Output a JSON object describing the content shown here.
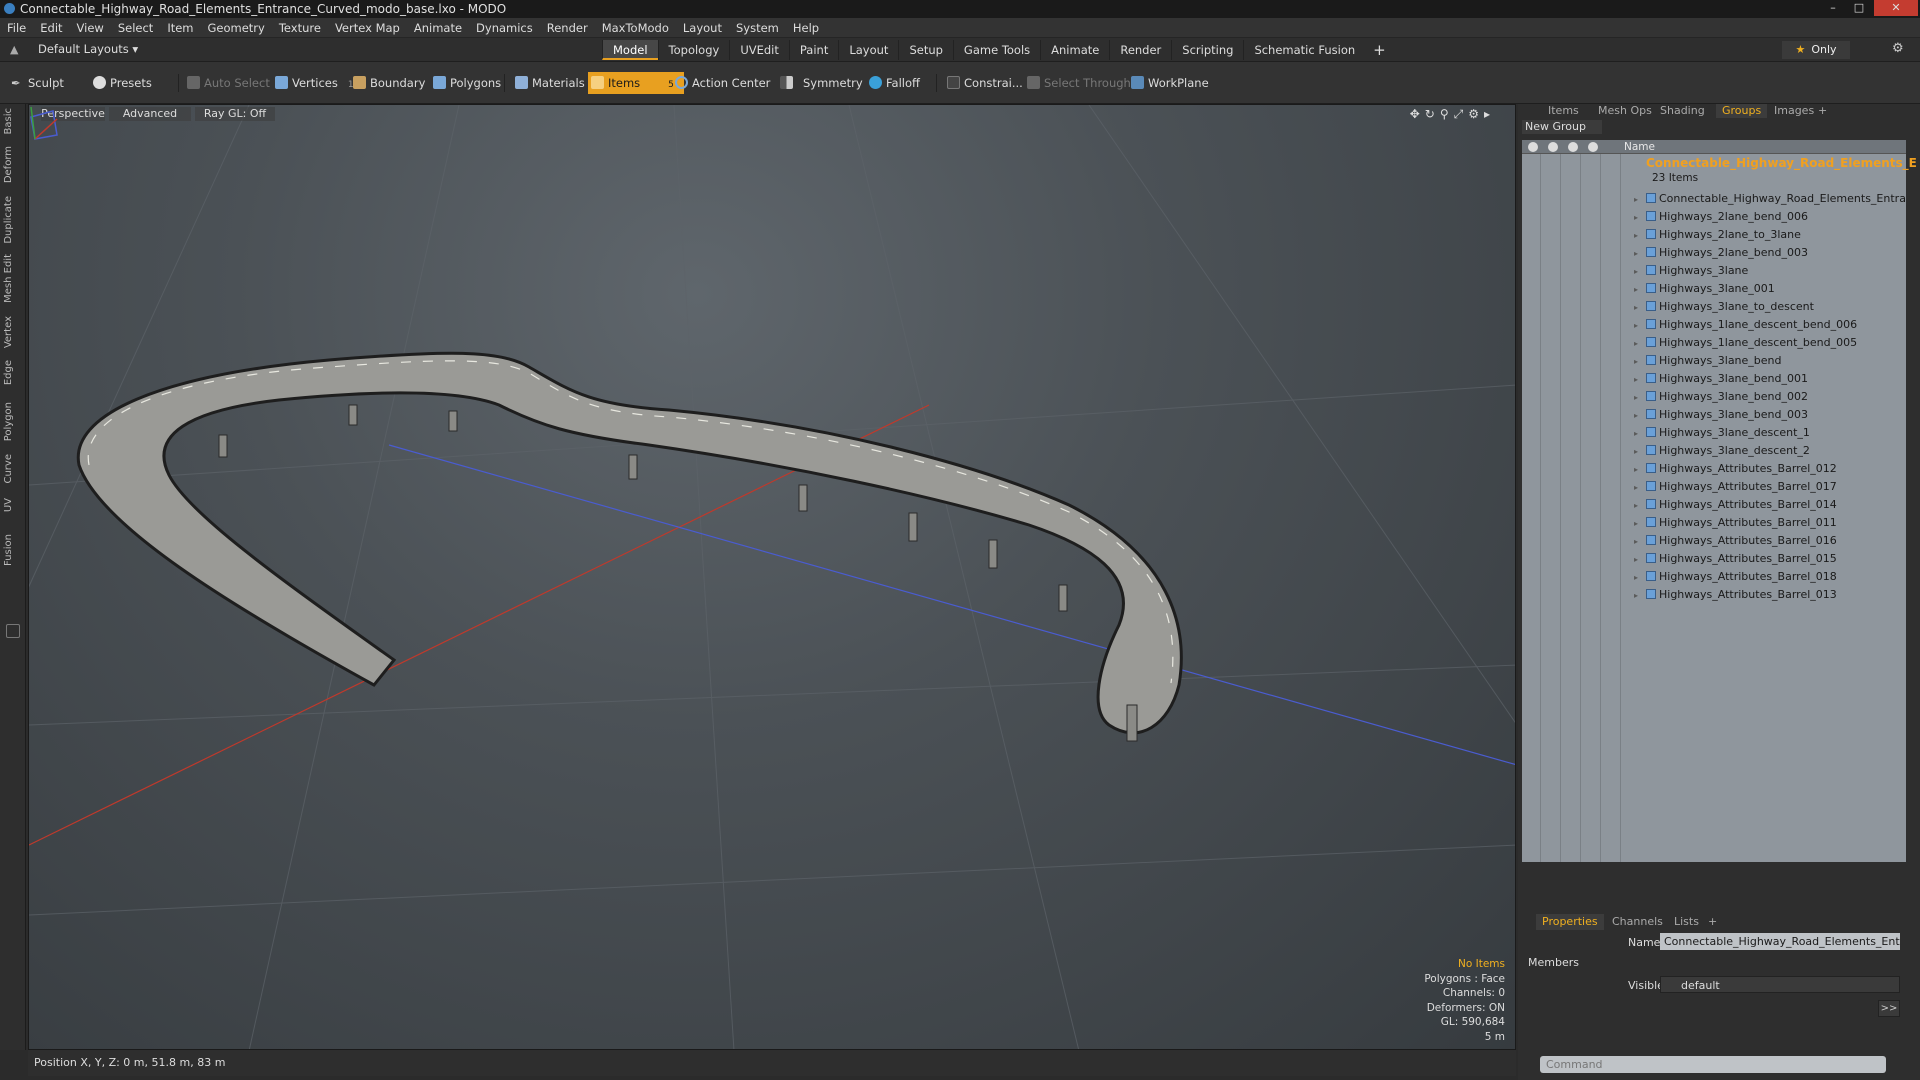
{
  "window": {
    "title": "Connectable_Highway_Road_Elements_Entrance_Curved_modo_base.lxo - MODO",
    "minimize": "–",
    "maximize": "□",
    "close": "✕"
  },
  "menu": [
    "File",
    "Edit",
    "View",
    "Select",
    "Item",
    "Geometry",
    "Texture",
    "Vertex Map",
    "Animate",
    "Dynamics",
    "Render",
    "MaxToModo",
    "Layout",
    "System",
    "Help"
  ],
  "layouts": {
    "label": "Default Layouts ▾",
    "tabs": [
      "Model",
      "Topology",
      "UVEdit",
      "Paint",
      "Layout",
      "Setup",
      "Game Tools",
      "Animate",
      "Render",
      "Scripting",
      "Schematic Fusion"
    ],
    "active_tab": "Model",
    "plus": "+",
    "only": "Only"
  },
  "toolbar": {
    "sculpt": "Sculpt",
    "presets": "Presets",
    "auto_select": "Auto Select",
    "vertices": "Vertices",
    "vertices_count": "1",
    "boundary": "Boundary",
    "polygons": "Polygons",
    "materials": "Materials",
    "items": "Items",
    "items_count": "5",
    "action_center": "Action Center",
    "symmetry": "Symmetry",
    "falloff": "Falloff",
    "constrain": "Constrai...",
    "select_through": "Select Through",
    "workplane": "WorkPlane"
  },
  "left_tabs": [
    "Basic",
    "Deform",
    "Duplicate",
    "Mesh Edit",
    "Vertex",
    "Edge",
    "Polygon",
    "Curve",
    "UV",
    "Fusion"
  ],
  "viewport": {
    "view": "Perspective",
    "shading": "Advanced",
    "raygl": "Ray GL: Off",
    "info": {
      "items": "No Items",
      "polygons": "Polygons : Face",
      "channels": "Channels: 0",
      "deformers": "Deformers: ON",
      "gl": "GL: 590,684",
      "scale": "5 m"
    }
  },
  "status": {
    "position": "Position X, Y, Z:   0 m, 51.8 m, 83 m"
  },
  "right_panel": {
    "tabs": [
      "Items",
      "Mesh Ops",
      "Shading",
      "Groups",
      "Images",
      "+"
    ],
    "active_tab": "Groups",
    "new_group": "New Group",
    "column_name": "Name",
    "group": {
      "name": "Connectable_Highway_Road_Elements_E ...",
      "count": "23 Items"
    },
    "items": [
      "Connectable_Highway_Road_Elements_Entran ...",
      "Highways_2lane_bend_006",
      "Highways_2lane_to_3lane",
      "Highways_2lane_bend_003",
      "Highways_3lane",
      "Highways_3lane_001",
      "Highways_3lane_to_descent",
      "Highways_1lane_descent_bend_006",
      "Highways_1lane_descent_bend_005",
      "Highways_3lane_bend",
      "Highways_3lane_bend_001",
      "Highways_3lane_bend_002",
      "Highways_3lane_bend_003",
      "Highways_3lane_descent_1",
      "Highways_3lane_descent_2",
      "Highways_Attributes_Barrel_012",
      "Highways_Attributes_Barrel_017",
      "Highways_Attributes_Barrel_014",
      "Highways_Attributes_Barrel_011",
      "Highways_Attributes_Barrel_016",
      "Highways_Attributes_Barrel_015",
      "Highways_Attributes_Barrel_018",
      "Highways_Attributes_Barrel_013"
    ],
    "prop_tabs": [
      "Properties",
      "Channels",
      "Lists",
      "+"
    ],
    "prop_active": "Properties",
    "name_label": "Name",
    "name_value": "Connectable_Highway_Road_Elements_Entra",
    "members": "Members",
    "visible_label": "Visible",
    "visible_value": "default",
    "more": ">>",
    "command_placeholder": "Command"
  },
  "colors": {
    "accent": "#e8a020",
    "x_axis": "#c0392b",
    "z_axis": "#4a5cd0"
  }
}
